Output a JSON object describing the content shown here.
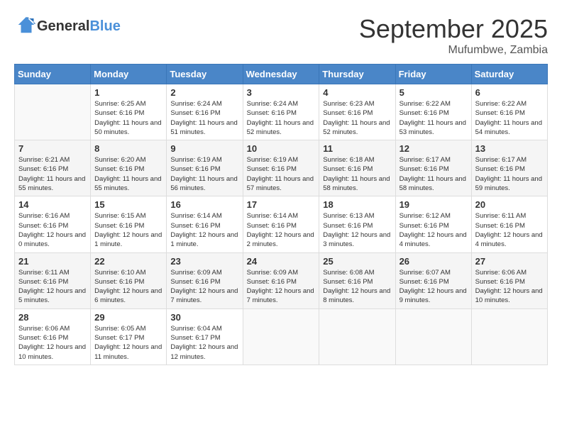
{
  "logo": {
    "general": "General",
    "blue": "Blue"
  },
  "title": "September 2025",
  "location": "Mufumbwe, Zambia",
  "weekdays": [
    "Sunday",
    "Monday",
    "Tuesday",
    "Wednesday",
    "Thursday",
    "Friday",
    "Saturday"
  ],
  "weeks": [
    [
      {
        "day": "",
        "empty": true
      },
      {
        "day": "1",
        "sunrise": "6:25 AM",
        "sunset": "6:16 PM",
        "daylight": "11 hours and 50 minutes."
      },
      {
        "day": "2",
        "sunrise": "6:24 AM",
        "sunset": "6:16 PM",
        "daylight": "11 hours and 51 minutes."
      },
      {
        "day": "3",
        "sunrise": "6:24 AM",
        "sunset": "6:16 PM",
        "daylight": "11 hours and 52 minutes."
      },
      {
        "day": "4",
        "sunrise": "6:23 AM",
        "sunset": "6:16 PM",
        "daylight": "11 hours and 52 minutes."
      },
      {
        "day": "5",
        "sunrise": "6:22 AM",
        "sunset": "6:16 PM",
        "daylight": "11 hours and 53 minutes."
      },
      {
        "day": "6",
        "sunrise": "6:22 AM",
        "sunset": "6:16 PM",
        "daylight": "11 hours and 54 minutes."
      }
    ],
    [
      {
        "day": "7",
        "sunrise": "6:21 AM",
        "sunset": "6:16 PM",
        "daylight": "11 hours and 55 minutes."
      },
      {
        "day": "8",
        "sunrise": "6:20 AM",
        "sunset": "6:16 PM",
        "daylight": "11 hours and 55 minutes."
      },
      {
        "day": "9",
        "sunrise": "6:19 AM",
        "sunset": "6:16 PM",
        "daylight": "11 hours and 56 minutes."
      },
      {
        "day": "10",
        "sunrise": "6:19 AM",
        "sunset": "6:16 PM",
        "daylight": "11 hours and 57 minutes."
      },
      {
        "day": "11",
        "sunrise": "6:18 AM",
        "sunset": "6:16 PM",
        "daylight": "11 hours and 58 minutes."
      },
      {
        "day": "12",
        "sunrise": "6:17 AM",
        "sunset": "6:16 PM",
        "daylight": "11 hours and 58 minutes."
      },
      {
        "day": "13",
        "sunrise": "6:17 AM",
        "sunset": "6:16 PM",
        "daylight": "11 hours and 59 minutes."
      }
    ],
    [
      {
        "day": "14",
        "sunrise": "6:16 AM",
        "sunset": "6:16 PM",
        "daylight": "12 hours and 0 minutes."
      },
      {
        "day": "15",
        "sunrise": "6:15 AM",
        "sunset": "6:16 PM",
        "daylight": "12 hours and 1 minute."
      },
      {
        "day": "16",
        "sunrise": "6:14 AM",
        "sunset": "6:16 PM",
        "daylight": "12 hours and 1 minute."
      },
      {
        "day": "17",
        "sunrise": "6:14 AM",
        "sunset": "6:16 PM",
        "daylight": "12 hours and 2 minutes."
      },
      {
        "day": "18",
        "sunrise": "6:13 AM",
        "sunset": "6:16 PM",
        "daylight": "12 hours and 3 minutes."
      },
      {
        "day": "19",
        "sunrise": "6:12 AM",
        "sunset": "6:16 PM",
        "daylight": "12 hours and 4 minutes."
      },
      {
        "day": "20",
        "sunrise": "6:11 AM",
        "sunset": "6:16 PM",
        "daylight": "12 hours and 4 minutes."
      }
    ],
    [
      {
        "day": "21",
        "sunrise": "6:11 AM",
        "sunset": "6:16 PM",
        "daylight": "12 hours and 5 minutes."
      },
      {
        "day": "22",
        "sunrise": "6:10 AM",
        "sunset": "6:16 PM",
        "daylight": "12 hours and 6 minutes."
      },
      {
        "day": "23",
        "sunrise": "6:09 AM",
        "sunset": "6:16 PM",
        "daylight": "12 hours and 7 minutes."
      },
      {
        "day": "24",
        "sunrise": "6:09 AM",
        "sunset": "6:16 PM",
        "daylight": "12 hours and 7 minutes."
      },
      {
        "day": "25",
        "sunrise": "6:08 AM",
        "sunset": "6:16 PM",
        "daylight": "12 hours and 8 minutes."
      },
      {
        "day": "26",
        "sunrise": "6:07 AM",
        "sunset": "6:16 PM",
        "daylight": "12 hours and 9 minutes."
      },
      {
        "day": "27",
        "sunrise": "6:06 AM",
        "sunset": "6:16 PM",
        "daylight": "12 hours and 10 minutes."
      }
    ],
    [
      {
        "day": "28",
        "sunrise": "6:06 AM",
        "sunset": "6:16 PM",
        "daylight": "12 hours and 10 minutes."
      },
      {
        "day": "29",
        "sunrise": "6:05 AM",
        "sunset": "6:17 PM",
        "daylight": "12 hours and 11 minutes."
      },
      {
        "day": "30",
        "sunrise": "6:04 AM",
        "sunset": "6:17 PM",
        "daylight": "12 hours and 12 minutes."
      },
      {
        "day": "",
        "empty": true
      },
      {
        "day": "",
        "empty": true
      },
      {
        "day": "",
        "empty": true
      },
      {
        "day": "",
        "empty": true
      }
    ]
  ],
  "labels": {
    "sunrise": "Sunrise:",
    "sunset": "Sunset:",
    "daylight": "Daylight:"
  }
}
